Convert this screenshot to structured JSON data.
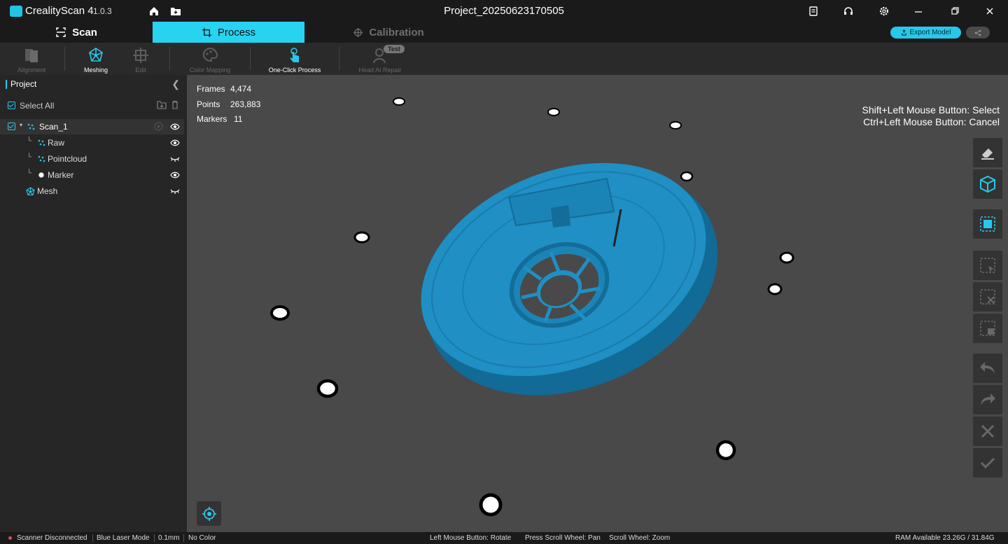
{
  "app": {
    "name": "CrealityScan 4",
    "version": "1.0.3",
    "project_title": "Project_20250623170505"
  },
  "tabs": {
    "scan": "Scan",
    "process": "Process",
    "calibration": "Calibration"
  },
  "header_buttons": {
    "export": "Export Model"
  },
  "toolbar": {
    "alignment": "Alignment",
    "meshing": "Meshing",
    "edit": "Edit",
    "color_mapping": "Color Mapping",
    "one_click": "One-Click Process",
    "head_ai": "Head AI Repair",
    "test_badge": "Test"
  },
  "project_panel": {
    "title": "Project",
    "select_all": "Select All",
    "tree": [
      {
        "label": "Scan_1",
        "icon": "scan-icon",
        "visible": true
      },
      {
        "label": "Raw",
        "icon": "pointcloud-icon",
        "visible": true
      },
      {
        "label": "Pointcloud",
        "icon": "pointcloud-icon",
        "visible": false
      },
      {
        "label": "Marker",
        "icon": "marker-icon",
        "visible": true
      },
      {
        "label": "Mesh",
        "icon": "mesh-icon",
        "visible": false
      }
    ]
  },
  "stats": {
    "frames_label": "Frames",
    "frames": "4,474",
    "points_label": "Points",
    "points": "263,883",
    "markers_label": "Markers",
    "markers": "11"
  },
  "hints": {
    "select": "Shift+Left Mouse Button: Select",
    "cancel": "Ctrl+Left Mouse Button: Cancel"
  },
  "status": {
    "scanner": "Scanner Disconnected",
    "mode": "Blue Laser Mode",
    "resolution": "0.1mm",
    "color": "No Color",
    "rotate": "Left Mouse Button: Rotate",
    "pan": "Press Scroll Wheel: Pan",
    "zoom": "Scroll Wheel: Zoom",
    "ram": "RAM Available 23.26G / 31.84G"
  },
  "colors": {
    "accent": "#27d3f0",
    "mesh": "#1f8fc4",
    "viewport": "#494949"
  }
}
